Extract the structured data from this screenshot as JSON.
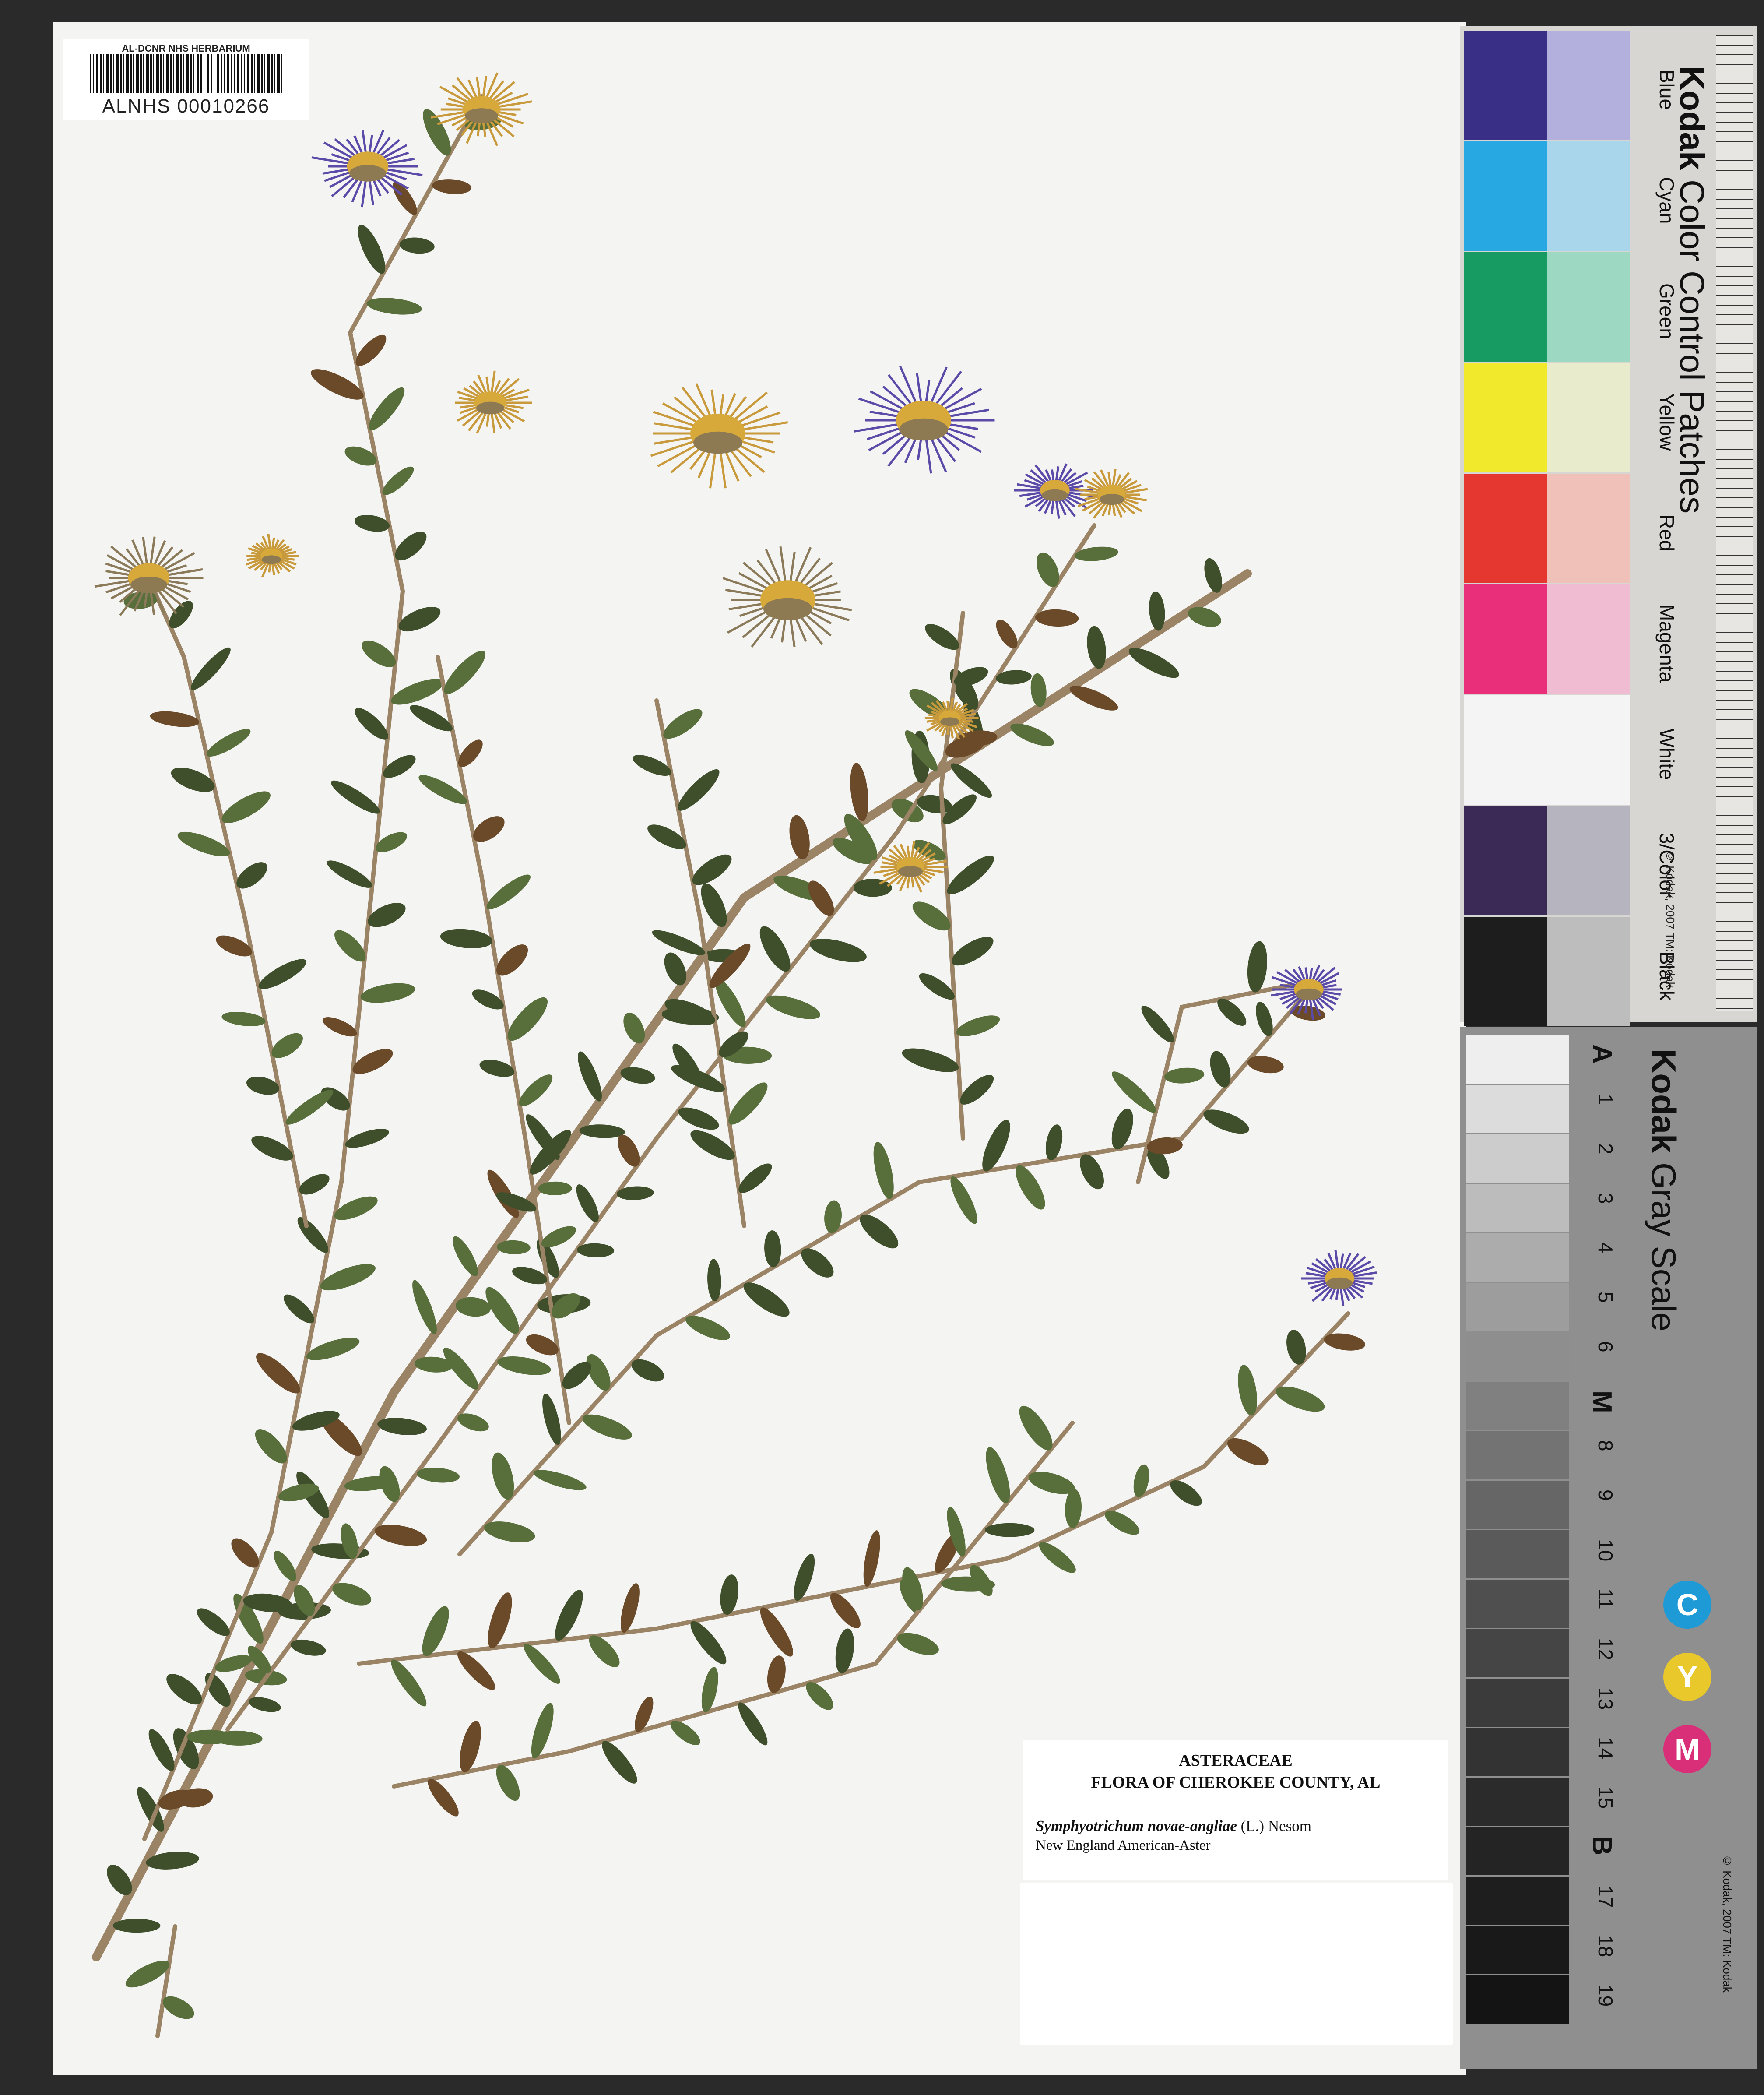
{
  "barcode": {
    "herbarium": "AL-DCNR NHS HERBARIUM",
    "catalog_number": "ALNHS 00010266"
  },
  "label": {
    "family": "ASTERACEAE",
    "flora": "FLORA OF CHEROKEE COUNTY, AL",
    "scientific_name": "Symphyotrichum novae-angliae",
    "authority": "(L.) Nesom",
    "common_name": "New England American-Aster"
  },
  "color_card": {
    "brand": "Kodak",
    "title": "Color Control Patches",
    "copyright": "© Kodak, 2007 TM: Kodak",
    "ruler_units": [
      "cm",
      "inches"
    ],
    "patches": [
      {
        "name": "Blue",
        "dark": "#3a2f86",
        "light": "#b3b0de"
      },
      {
        "name": "Cyan",
        "dark": "#28a8e3",
        "light": "#a9d6ea"
      },
      {
        "name": "Green",
        "dark": "#189a63",
        "light": "#9dd8c2"
      },
      {
        "name": "Yellow",
        "dark": "#f1ea2c",
        "light": "#e8ebcc"
      },
      {
        "name": "Red",
        "dark": "#e5362f",
        "light": "#f0c1b9"
      },
      {
        "name": "Magenta",
        "dark": "#ea2f7a",
        "light": "#efbcd2"
      },
      {
        "name": "White",
        "dark": "#f4f4f4",
        "light": "#f4f4f4"
      },
      {
        "name": "3/Color",
        "dark": "#3a2a55",
        "light": "#b6b4bf"
      },
      {
        "name": "Black",
        "dark": "#1d1d1d",
        "light": "#bdbdbd"
      }
    ]
  },
  "gray_card": {
    "brand": "Kodak",
    "title": "Gray Scale",
    "copyright": "© Kodak, 2007 TM: Kodak",
    "steps": [
      "A",
      "1",
      "2",
      "3",
      "4",
      "5",
      "6",
      "M",
      "8",
      "9",
      "10",
      "11",
      "12",
      "13",
      "14",
      "15",
      "B",
      "17",
      "18",
      "19"
    ],
    "tones": [
      "#eeeeee",
      "#dcdcdc",
      "#cccccc",
      "#bcbcbc",
      "#acacac",
      "#9d9d9d",
      "#8e8e8e",
      "#808080",
      "#737373",
      "#666666",
      "#5a5a5a",
      "#4f4f4f",
      "#454545",
      "#3b3b3b",
      "#333333",
      "#2b2b2b",
      "#242424",
      "#1e1e1e",
      "#191919",
      "#141414"
    ],
    "cmy": [
      {
        "letter": "C",
        "color": "#1e9ad6"
      },
      {
        "letter": "Y",
        "color": "#e8c82a"
      },
      {
        "letter": "M",
        "color": "#d92f78"
      }
    ]
  },
  "colors": {
    "leaf": "#586f3c",
    "leaf_dark": "#3f4f2b",
    "stem": "#9b8466",
    "ray_purple": "#5c4aa8",
    "disk_yellow": "#d6a93a"
  }
}
